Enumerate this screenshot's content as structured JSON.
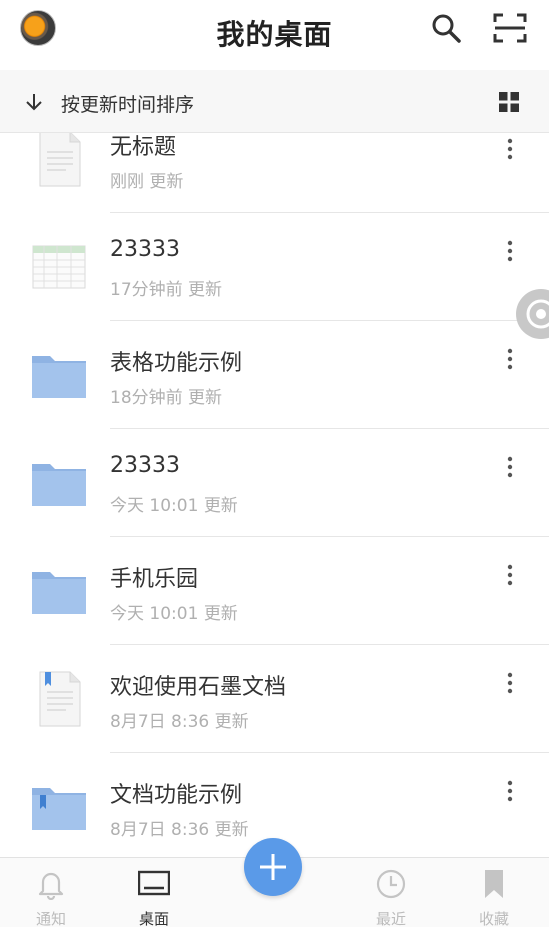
{
  "header": {
    "title": "我的桌面",
    "avatar_icon": "orange-ball-avatar",
    "search_icon": "search-icon",
    "scan_icon": "scan-icon"
  },
  "sort_bar": {
    "label": "按更新时间排序",
    "arrow_icon": "arrow-down-icon",
    "view_icon": "grid-view-icon"
  },
  "files": [
    {
      "name": "无标题",
      "time": "刚刚",
      "suffix": "更新",
      "type": "document"
    },
    {
      "name": "23333",
      "time": "17分钟前",
      "suffix": "更新",
      "type": "spreadsheet"
    },
    {
      "name": "表格功能示例",
      "time": "18分钟前",
      "suffix": "更新",
      "type": "folder"
    },
    {
      "name": "23333",
      "time": "今天 10:01",
      "suffix": "更新",
      "type": "folder"
    },
    {
      "name": "手机乐园",
      "time": "今天 10:01",
      "suffix": "更新",
      "type": "folder"
    },
    {
      "name": "欢迎使用石墨文档",
      "time": "8月7日 8:36",
      "suffix": "更新",
      "type": "document-bookmarked"
    },
    {
      "name": "文档功能示例",
      "time": "8月7日 8:36",
      "suffix": "更新",
      "type": "folder-bookmarked"
    }
  ],
  "bottom_nav": {
    "items": [
      {
        "label": "通知",
        "icon": "bell-icon",
        "active": false
      },
      {
        "label": "桌面",
        "icon": "desktop-icon",
        "active": true
      },
      {
        "label": "最近",
        "icon": "clock-icon",
        "active": false
      },
      {
        "label": "收藏",
        "icon": "bookmark-icon",
        "active": false
      }
    ],
    "add_icon": "plus-icon"
  },
  "colors": {
    "accent": "#5a9ae8",
    "folder": "#9dbfea",
    "muted_text": "#b0b0b0"
  }
}
